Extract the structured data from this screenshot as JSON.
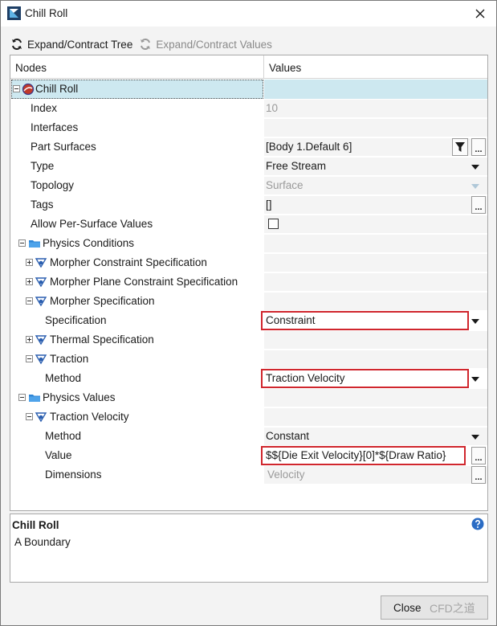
{
  "window": {
    "title": "Chill Roll"
  },
  "toolbar": {
    "expand_tree": "Expand/Contract Tree",
    "expand_values": "Expand/Contract Values"
  },
  "grid": {
    "header": {
      "nodes": "Nodes",
      "values": "Values"
    },
    "rows": [
      {
        "label": "Chill Roll",
        "value": ""
      },
      {
        "label": "Index",
        "value": "10"
      },
      {
        "label": "Interfaces",
        "value": ""
      },
      {
        "label": "Part Surfaces",
        "value": "[Body 1.Default 6]"
      },
      {
        "label": "Type",
        "value": "Free Stream"
      },
      {
        "label": "Topology",
        "value": "Surface"
      },
      {
        "label": "Tags",
        "value": "[]"
      },
      {
        "label": "Allow Per-Surface Values",
        "value": ""
      },
      {
        "label": "Physics Conditions",
        "value": ""
      },
      {
        "label": "Morpher Constraint Specification",
        "value": ""
      },
      {
        "label": "Morpher Plane Constraint Specification",
        "value": ""
      },
      {
        "label": "Morpher Specification",
        "value": ""
      },
      {
        "label": "Specification",
        "value": "Constraint"
      },
      {
        "label": "Thermal Specification",
        "value": ""
      },
      {
        "label": "Traction",
        "value": ""
      },
      {
        "label": "Method",
        "value": "Traction Velocity"
      },
      {
        "label": "Physics Values",
        "value": ""
      },
      {
        "label": "Traction Velocity",
        "value": ""
      },
      {
        "label": "Method",
        "value": "Constant"
      },
      {
        "label": "Value",
        "value": "$${Die Exit Velocity}[0]*${Draw Ratio}"
      },
      {
        "label": "Dimensions",
        "value": "Velocity"
      }
    ]
  },
  "description": {
    "title": "Chill Roll",
    "body": "A Boundary"
  },
  "footer": {
    "close_label": "Close",
    "watermark": "CFD之道"
  },
  "icons": {
    "app": "star-ccm-icon",
    "boundary": "boundary-icon",
    "folder": "folder-icon",
    "physics": "physics-condition-icon",
    "help": "help-icon",
    "filter": "filter-icon"
  },
  "colors": {
    "selection": "#cde8f0",
    "highlight_box": "#d0262d",
    "help": "#2b6cc4"
  }
}
